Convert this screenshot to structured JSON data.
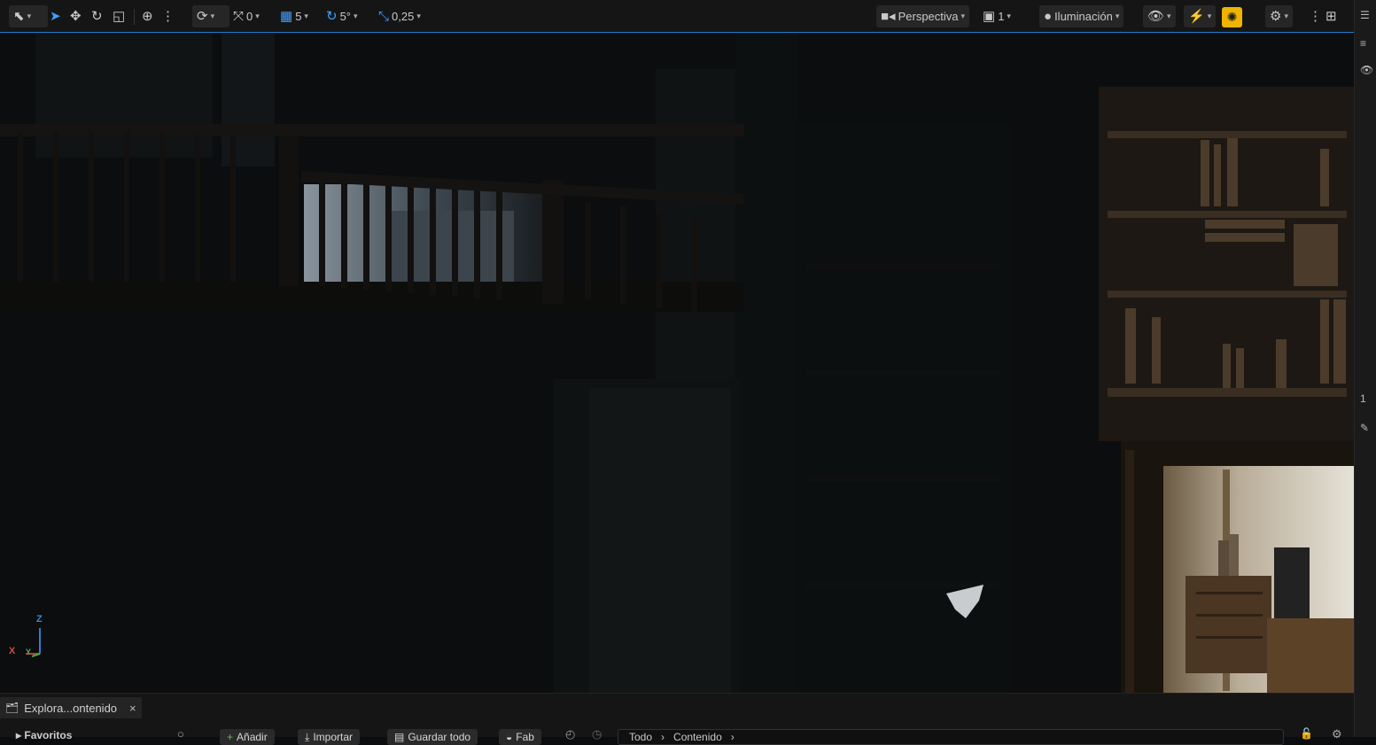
{
  "toolbar": {
    "snap_translate_value": "0",
    "snap_grid_value": "5",
    "snap_rotate_value": "5°",
    "snap_scale_value": "0,25",
    "view_mode_label": "Perspectiva",
    "camera_speed_value": "1",
    "lighting_label": "Iluminación"
  },
  "viewport": {
    "axis_z": "Z",
    "axis_x": "X",
    "axis_y": "Y"
  },
  "right_strip": {
    "marker_label": "1"
  },
  "bottom": {
    "tab_label": "Explora...ontenido",
    "close_glyph": "×",
    "favorites_label": "Favoritos",
    "add_label": "Añadir",
    "import_label": "Importar",
    "save_all_label": "Guardar todo",
    "fab_label": "Fab",
    "path_items": [
      "Todo",
      "Contenido"
    ]
  },
  "colors": {
    "accent_blue": "#3ea0ff",
    "active_yellow": "#f0b400",
    "toolbar_bg": "#151515"
  }
}
